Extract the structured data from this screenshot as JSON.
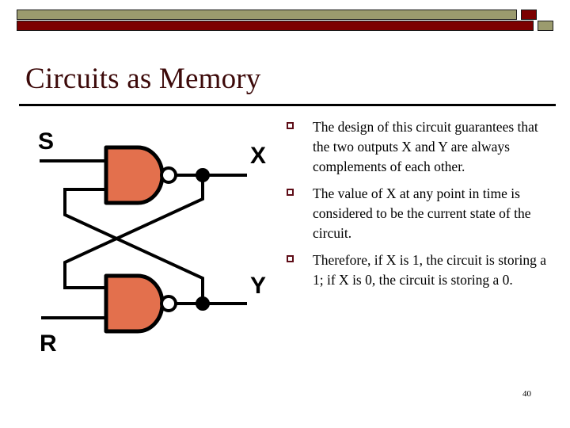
{
  "slide": {
    "title": "Circuits as Memory",
    "page_number": "40",
    "title_color": "#3d0a0a",
    "banner": {
      "olive_color": "#9b9b6e",
      "dark_red_color": "#7c0000",
      "outline_color": "#1a1a1a"
    }
  },
  "bullets": [
    {
      "marker": "hollow-square",
      "text": "The design of this circuit guarantees that the two outputs X and Y are always complements of each other."
    },
    {
      "marker": "hollow-square",
      "text": "The value of X at any point in time is considered to be the current state of the circuit."
    },
    {
      "marker": "hollow-square",
      "text": " Therefore, if X is 1, the circuit is storing a 1; if X is 0, the circuit is storing a 0."
    }
  ],
  "circuit": {
    "type": "sr-latch",
    "gate_fill_color": "#e3704d",
    "gate_outline_color": "#000000",
    "wire_color": "#000000",
    "labels": {
      "input_top": "S",
      "input_bottom": "R",
      "output_top": "X",
      "output_bottom": "Y"
    },
    "gates": [
      {
        "name": "nand-gate-top",
        "kind": "NAND"
      },
      {
        "name": "nand-gate-bottom",
        "kind": "NAND"
      }
    ],
    "junction_dots": 2
  }
}
